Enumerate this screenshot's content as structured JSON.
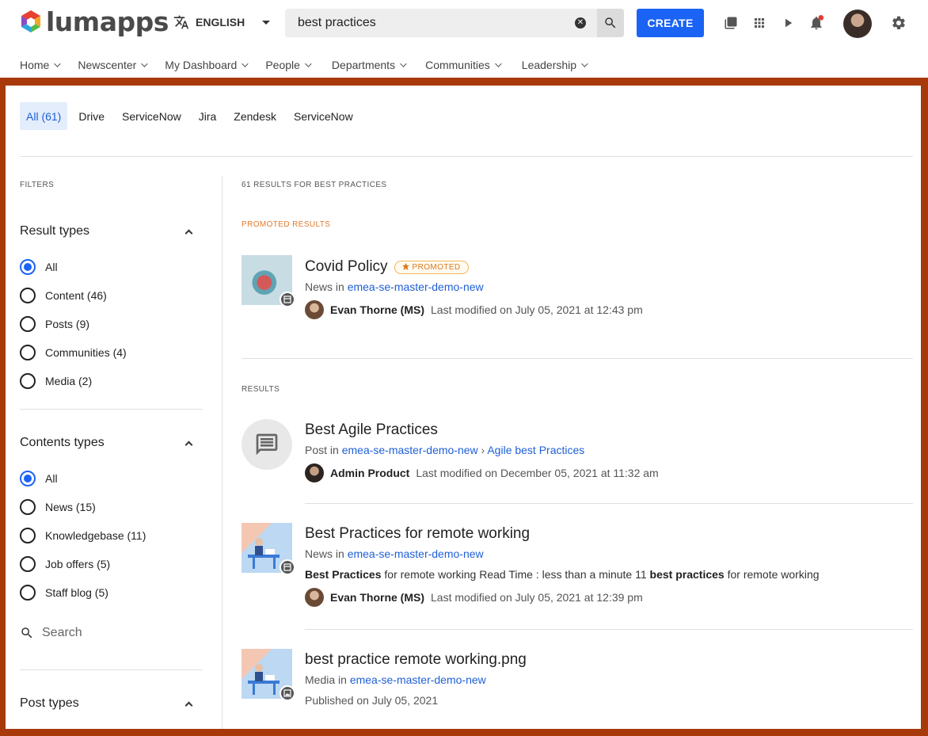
{
  "brand": {
    "logo_text": "lumapps"
  },
  "header": {
    "language": "ENGLISH",
    "search_value": "best practices",
    "create_label": "CREATE"
  },
  "nav": [
    "Home",
    "Newscenter",
    "My Dashboard",
    "People",
    "Departments",
    "Communities",
    "Leadership"
  ],
  "tabs": [
    "All (61)",
    "Drive",
    "ServiceNow",
    "Jira",
    "Zendesk",
    "ServiceNow"
  ],
  "filters": {
    "label": "FILTERS",
    "result_types": {
      "title": "Result types",
      "options": [
        "All",
        "Content (46)",
        "Posts (9)",
        "Communities (4)",
        "Media (2)"
      ]
    },
    "content_types": {
      "title": "Contents types",
      "options": [
        "All",
        "News (15)",
        "Knowledgebase (11)",
        "Job offers (5)",
        "Staff blog (5)"
      ]
    },
    "search_placeholder": "Search",
    "post_types": {
      "title": "Post types"
    }
  },
  "results": {
    "count_label": "61 RESULTS FOR BEST PRACTICES",
    "promoted_label": "PROMOTED RESULTS",
    "results_label": "RESULTS",
    "items": [
      {
        "title": "Covid Policy",
        "badge": "PROMOTED",
        "type_prefix": "News in",
        "location": "emea-se-master-demo-new",
        "author": "Evan Thorne (MS)",
        "modified": "Last modified on July 05, 2021 at 12:43 pm"
      },
      {
        "title": "Best Agile Practices",
        "type_prefix": "Post in",
        "location": "emea-se-master-demo-new",
        "sublocation": "Agile best Practices",
        "author": "Admin Product",
        "modified": "Last modified on December 05, 2021 at 11:32 am"
      },
      {
        "title": "Best Practices for remote working",
        "type_prefix": "News in",
        "location": "emea-se-master-demo-new",
        "excerpt_bold1": "Best Practices",
        "excerpt_mid": " for remote working Read Time : less than a minute 11 ",
        "excerpt_bold2": "best practices",
        "excerpt_end": " for remote working",
        "author": "Evan Thorne (MS)",
        "modified": "Last modified on July 05, 2021 at 12:39 pm"
      },
      {
        "title": "best practice remote working.png",
        "type_prefix": "Media in",
        "location": "emea-se-master-demo-new",
        "published": "Published on July 05, 2021"
      }
    ]
  },
  "colors": {
    "accent": "#1b63f5",
    "frame": "#a8390b",
    "link": "#1f5fd6",
    "promo": "#e07a2e"
  }
}
